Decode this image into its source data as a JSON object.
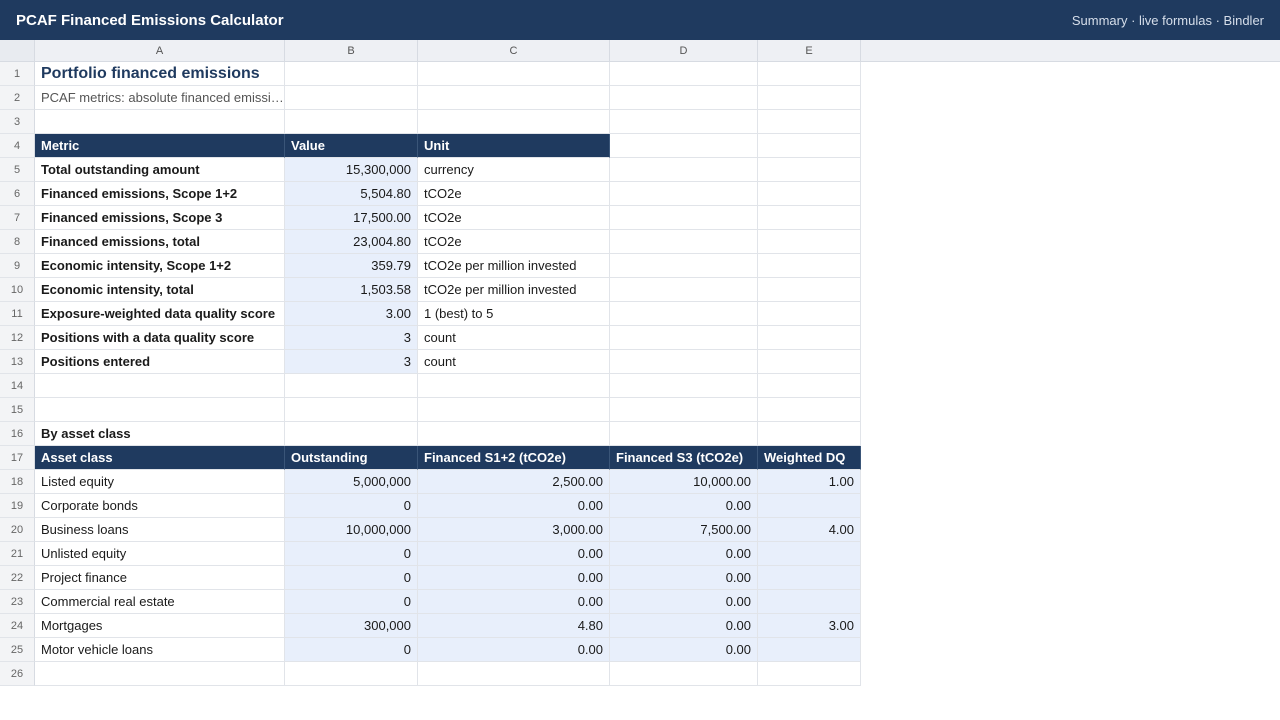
{
  "app": {
    "title": "PCAF Financed Emissions Calculator",
    "meta": "Summary · live formulas · Bindler"
  },
  "columns": [
    "A",
    "B",
    "C",
    "D",
    "E"
  ],
  "rows": [
    "1",
    "2",
    "3",
    "4",
    "5",
    "6",
    "7",
    "8",
    "9",
    "10",
    "11",
    "12",
    "13",
    "14",
    "15",
    "16",
    "17",
    "18",
    "19",
    "20",
    "21",
    "22",
    "23",
    "24",
    "25",
    "26"
  ],
  "sheet": {
    "title": "Portfolio financed emissions",
    "subtitle": "PCAF metrics: absolute financed emissi…"
  },
  "metrics_table": {
    "headers": [
      "Metric",
      "Value",
      "Unit"
    ],
    "rows": [
      {
        "metric": "Total outstanding amount",
        "value": "15,300,000",
        "unit": "currency"
      },
      {
        "metric": "Financed emissions, Scope 1+2",
        "value": "5,504.80",
        "unit": "tCO2e"
      },
      {
        "metric": "Financed emissions, Scope 3",
        "value": "17,500.00",
        "unit": "tCO2e"
      },
      {
        "metric": "Financed emissions, total",
        "value": "23,004.80",
        "unit": "tCO2e"
      },
      {
        "metric": "Economic intensity, Scope 1+2",
        "value": "359.79",
        "unit": "tCO2e per million invested"
      },
      {
        "metric": "Economic intensity, total",
        "value": "1,503.58",
        "unit": "tCO2e per million invested"
      },
      {
        "metric": "Exposure-weighted data quality score",
        "value": "3.00",
        "unit": "1 (best) to 5"
      },
      {
        "metric": "Positions with a data quality score",
        "value": "3",
        "unit": "count"
      },
      {
        "metric": "Positions entered",
        "value": "3",
        "unit": "count"
      }
    ]
  },
  "asset_class_section": {
    "label": "By asset class",
    "headers": [
      "Asset class",
      "Outstanding",
      "Financed S1+2 (tCO2e)",
      "Financed S3 (tCO2e)",
      "Weighted DQ"
    ],
    "rows": [
      {
        "asset_class": "Listed equity",
        "outstanding": "5,000,000",
        "s12": "2,500.00",
        "s3": "10,000.00",
        "dq": "1.00"
      },
      {
        "asset_class": "Corporate bonds",
        "outstanding": "0",
        "s12": "0.00",
        "s3": "0.00",
        "dq": ""
      },
      {
        "asset_class": "Business loans",
        "outstanding": "10,000,000",
        "s12": "3,000.00",
        "s3": "7,500.00",
        "dq": "4.00"
      },
      {
        "asset_class": "Unlisted equity",
        "outstanding": "0",
        "s12": "0.00",
        "s3": "0.00",
        "dq": ""
      },
      {
        "asset_class": "Project finance",
        "outstanding": "0",
        "s12": "0.00",
        "s3": "0.00",
        "dq": ""
      },
      {
        "asset_class": "Commercial real estate",
        "outstanding": "0",
        "s12": "0.00",
        "s3": "0.00",
        "dq": ""
      },
      {
        "asset_class": "Mortgages",
        "outstanding": "300,000",
        "s12": "4.80",
        "s3": "0.00",
        "dq": "3.00"
      },
      {
        "asset_class": "Motor vehicle loans",
        "outstanding": "0",
        "s12": "0.00",
        "s3": "0.00",
        "dq": ""
      }
    ]
  },
  "colors": {
    "header_bar": "#1f3a5f",
    "input_cell": "#e8effb",
    "grid_line": "#e1e4e9"
  }
}
